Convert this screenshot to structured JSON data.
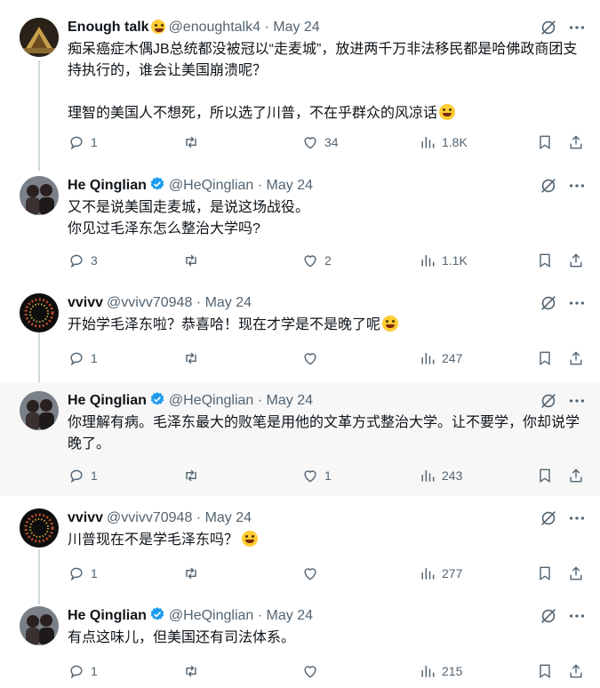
{
  "tweets": [
    {
      "name": "Enough talk",
      "name_emoji": "grimacing-face",
      "handle": "@enoughtalk4",
      "date": "May 24",
      "verified": false,
      "text_lines": [
        "痴呆癌症木偶JB总统都没被冠以“走麦城”，放进两千万非法移民都是哈佛政商团支持执行的，谁会让美国崩溃呢？",
        "",
        "理智的美国人不想死，所以选了川普，不在乎群众的风凉话"
      ],
      "trailing_emoji": "grinning-face",
      "replies": "1",
      "retweets": "",
      "likes": "34",
      "views": "1.8K"
    },
    {
      "name": "He Qinglian",
      "handle": "@HeQinglian",
      "date": "May 24",
      "verified": true,
      "text_lines": [
        "又不是说美国走麦城，是说这场战役。",
        "你见过毛泽东怎么整治大学吗?"
      ],
      "replies": "3",
      "retweets": "",
      "likes": "2",
      "views": "1.1K"
    },
    {
      "name": "vvivv",
      "handle": "@vvivv70948",
      "date": "May 24",
      "verified": false,
      "text_lines": [
        "开始学毛泽东啦？恭喜哈！现在才学是不是晚了呢"
      ],
      "trailing_emoji": "grinning-face",
      "replies": "1",
      "retweets": "",
      "likes": "",
      "views": "247"
    },
    {
      "name": "He Qinglian",
      "handle": "@HeQinglian",
      "date": "May 24",
      "verified": true,
      "text_lines": [
        "你理解有病。毛泽东最大的败笔是用他的文革方式整治大学。让不要学，你却说学晚了。"
      ],
      "replies": "1",
      "retweets": "",
      "likes": "1",
      "views": "243"
    },
    {
      "name": "vvivv",
      "handle": "@vvivv70948",
      "date": "May 24",
      "verified": false,
      "text_lines": [
        "川普现在不是学毛泽东吗？"
      ],
      "trailing_emoji": "crying-laughing-face",
      "replies": "1",
      "retweets": "",
      "likes": "",
      "views": "277"
    },
    {
      "name": "He Qinglian",
      "handle": "@HeQinglian",
      "date": "May 24",
      "verified": true,
      "text_lines": [
        "有点这味儿，但美国还有司法体系。"
      ],
      "replies": "1",
      "retweets": "",
      "likes": "",
      "views": "215"
    }
  ],
  "meta_separator": "·",
  "colors": {
    "text": "#0f1419",
    "muted": "#536471",
    "verified": "#1d9bf0",
    "thread_line": "#cfd9de",
    "highlight_bg": "#f7f7f7"
  },
  "icons": {
    "reply": "reply-icon",
    "retweet": "retweet-icon",
    "like": "like-icon",
    "views": "views-icon",
    "bookmark": "bookmark-icon",
    "share": "share-icon",
    "hide": "hide-reply-icon",
    "more": "more-icon"
  }
}
